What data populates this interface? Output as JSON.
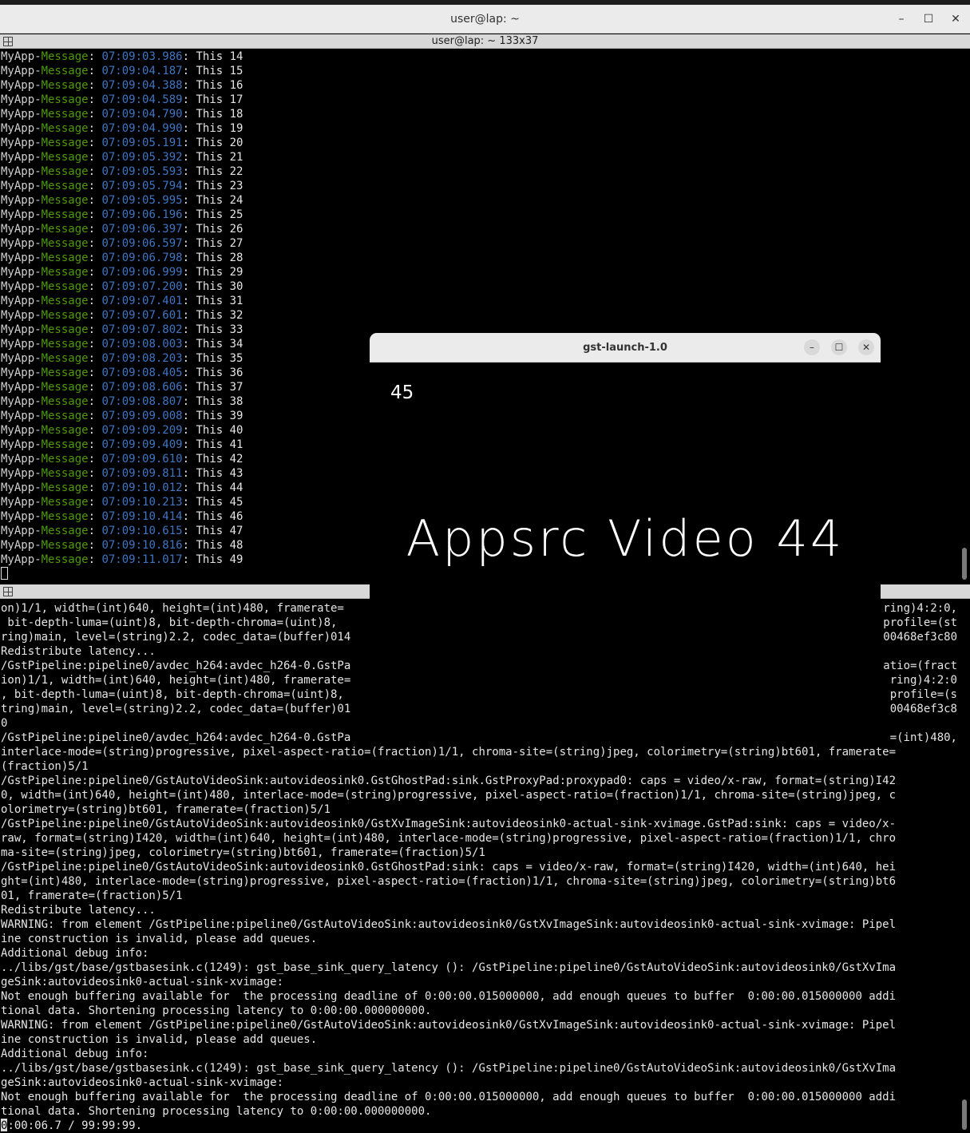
{
  "window": {
    "title": "user@lap: ~",
    "minimize": "–",
    "maximize": "☐",
    "close": "✕"
  },
  "top_pane": {
    "title": "user@lap: ~ 133x37",
    "lines": [
      {
        "app": "MyApp-",
        "level": "Message",
        "ts": "07:09:03.986",
        "text": ": This 14"
      },
      {
        "app": "MyApp-",
        "level": "Message",
        "ts": "07:09:04.187",
        "text": ": This 15"
      },
      {
        "app": "MyApp-",
        "level": "Message",
        "ts": "07:09:04.388",
        "text": ": This 16"
      },
      {
        "app": "MyApp-",
        "level": "Message",
        "ts": "07:09:04.589",
        "text": ": This 17"
      },
      {
        "app": "MyApp-",
        "level": "Message",
        "ts": "07:09:04.790",
        "text": ": This 18"
      },
      {
        "app": "MyApp-",
        "level": "Message",
        "ts": "07:09:04.990",
        "text": ": This 19"
      },
      {
        "app": "MyApp-",
        "level": "Message",
        "ts": "07:09:05.191",
        "text": ": This 20"
      },
      {
        "app": "MyApp-",
        "level": "Message",
        "ts": "07:09:05.392",
        "text": ": This 21"
      },
      {
        "app": "MyApp-",
        "level": "Message",
        "ts": "07:09:05.593",
        "text": ": This 22"
      },
      {
        "app": "MyApp-",
        "level": "Message",
        "ts": "07:09:05.794",
        "text": ": This 23"
      },
      {
        "app": "MyApp-",
        "level": "Message",
        "ts": "07:09:05.995",
        "text": ": This 24"
      },
      {
        "app": "MyApp-",
        "level": "Message",
        "ts": "07:09:06.196",
        "text": ": This 25"
      },
      {
        "app": "MyApp-",
        "level": "Message",
        "ts": "07:09:06.397",
        "text": ": This 26"
      },
      {
        "app": "MyApp-",
        "level": "Message",
        "ts": "07:09:06.597",
        "text": ": This 27"
      },
      {
        "app": "MyApp-",
        "level": "Message",
        "ts": "07:09:06.798",
        "text": ": This 28"
      },
      {
        "app": "MyApp-",
        "level": "Message",
        "ts": "07:09:06.999",
        "text": ": This 29"
      },
      {
        "app": "MyApp-",
        "level": "Message",
        "ts": "07:09:07.200",
        "text": ": This 30"
      },
      {
        "app": "MyApp-",
        "level": "Message",
        "ts": "07:09:07.401",
        "text": ": This 31"
      },
      {
        "app": "MyApp-",
        "level": "Message",
        "ts": "07:09:07.601",
        "text": ": This 32"
      },
      {
        "app": "MyApp-",
        "level": "Message",
        "ts": "07:09:07.802",
        "text": ": This 33"
      },
      {
        "app": "MyApp-",
        "level": "Message",
        "ts": "07:09:08.003",
        "text": ": This 34"
      },
      {
        "app": "MyApp-",
        "level": "Message",
        "ts": "07:09:08.203",
        "text": ": This 35"
      },
      {
        "app": "MyApp-",
        "level": "Message",
        "ts": "07:09:08.405",
        "text": ": This 36"
      },
      {
        "app": "MyApp-",
        "level": "Message",
        "ts": "07:09:08.606",
        "text": ": This 37"
      },
      {
        "app": "MyApp-",
        "level": "Message",
        "ts": "07:09:08.807",
        "text": ": This 38"
      },
      {
        "app": "MyApp-",
        "level": "Message",
        "ts": "07:09:09.008",
        "text": ": This 39"
      },
      {
        "app": "MyApp-",
        "level": "Message",
        "ts": "07:09:09.209",
        "text": ": This 40"
      },
      {
        "app": "MyApp-",
        "level": "Message",
        "ts": "07:09:09.409",
        "text": ": This 41"
      },
      {
        "app": "MyApp-",
        "level": "Message",
        "ts": "07:09:09.610",
        "text": ": This 42"
      },
      {
        "app": "MyApp-",
        "level": "Message",
        "ts": "07:09:09.811",
        "text": ": This 43"
      },
      {
        "app": "MyApp-",
        "level": "Message",
        "ts": "07:09:10.012",
        "text": ": This 44"
      },
      {
        "app": "MyApp-",
        "level": "Message",
        "ts": "07:09:10.213",
        "text": ": This 45"
      },
      {
        "app": "MyApp-",
        "level": "Message",
        "ts": "07:09:10.414",
        "text": ": This 46"
      },
      {
        "app": "MyApp-",
        "level": "Message",
        "ts": "07:09:10.615",
        "text": ": This 47"
      },
      {
        "app": "MyApp-",
        "level": "Message",
        "ts": "07:09:10.816",
        "text": ": This 48"
      },
      {
        "app": "MyApp-",
        "level": "Message",
        "ts": "07:09:11.017",
        "text": ": This 49"
      }
    ]
  },
  "bottom_pane": {
    "lines": [
      "on)1/1, width=(int)640, height=(int)480, framerate=",
      " bit-depth-luma=(uint)8, bit-depth-chroma=(uint)8, ",
      "ring)main, level=(string)2.2, codec_data=(buffer)014",
      "Redistribute latency...",
      "/GstPipeline:pipeline0/avdec_h264:avdec_h264-0.GstPa",
      "ion)1/1, width=(int)640, height=(int)480, framerate=",
      ", bit-depth-luma=(uint)8, bit-depth-chroma=(uint)8, ",
      "tring)main, level=(string)2.2, codec_data=(buffer)01",
      "0",
      "/GstPipeline:pipeline0/avdec_h264:avdec_h264-0.GstPa",
      "interlace-mode=(string)progressive, pixel-aspect-ratio=(fraction)1/1, chroma-site=(string)jpeg, colorimetry=(string)bt601, framerate=",
      "(fraction)5/1",
      "/GstPipeline:pipeline0/GstAutoVideoSink:autovideosink0.GstGhostPad:sink.GstProxyPad:proxypad0: caps = video/x-raw, format=(string)I42",
      "0, width=(int)640, height=(int)480, interlace-mode=(string)progressive, pixel-aspect-ratio=(fraction)1/1, chroma-site=(string)jpeg, c",
      "olorimetry=(string)bt601, framerate=(fraction)5/1",
      "/GstPipeline:pipeline0/GstAutoVideoSink:autovideosink0/GstXvImageSink:autovideosink0-actual-sink-xvimage.GstPad:sink: caps = video/x-",
      "raw, format=(string)I420, width=(int)640, height=(int)480, interlace-mode=(string)progressive, pixel-aspect-ratio=(fraction)1/1, chro",
      "ma-site=(string)jpeg, colorimetry=(string)bt601, framerate=(fraction)5/1",
      "/GstPipeline:pipeline0/GstAutoVideoSink:autovideosink0.GstGhostPad:sink: caps = video/x-raw, format=(string)I420, width=(int)640, hei",
      "ght=(int)480, interlace-mode=(string)progressive, pixel-aspect-ratio=(fraction)1/1, chroma-site=(string)jpeg, colorimetry=(string)bt6",
      "01, framerate=(fraction)5/1",
      "Redistribute latency...",
      "WARNING: from element /GstPipeline:pipeline0/GstAutoVideoSink:autovideosink0/GstXvImageSink:autovideosink0-actual-sink-xvimage: Pipel",
      "ine construction is invalid, please add queues.",
      "Additional debug info:",
      "../libs/gst/base/gstbasesink.c(1249): gst_base_sink_query_latency (): /GstPipeline:pipeline0/GstAutoVideoSink:autovideosink0/GstXvIma",
      "geSink:autovideosink0-actual-sink-xvimage:",
      "Not enough buffering available for  the processing deadline of 0:00:00.015000000, add enough queues to buffer  0:00:00.015000000 addi",
      "tional data. Shortening processing latency to 0:00:00.000000000.",
      "WARNING: from element /GstPipeline:pipeline0/GstAutoVideoSink:autovideosink0/GstXvImageSink:autovideosink0-actual-sink-xvimage: Pipel",
      "ine construction is invalid, please add queues.",
      "Additional debug info:",
      "../libs/gst/base/gstbasesink.c(1249): gst_base_sink_query_latency (): /GstPipeline:pipeline0/GstAutoVideoSink:autovideosink0/GstXvIma",
      "geSink:autovideosink0-actual-sink-xvimage:",
      "Not enough buffering available for  the processing deadline of 0:00:00.015000000, add enough queues to buffer  0:00:00.015000000 addi",
      "tional data. Shortening processing latency to 0:00:00.000000000."
    ],
    "right_fragments": [
      "ring)4:2:0,",
      "profile=(st",
      "00468ef3c80",
      "",
      "atio=(fract",
      "ring)4:2:0",
      "profile=(s",
      "00468ef3c8",
      "",
      "=(int)480,"
    ],
    "status_first": "0",
    "status_rest": ":00:06.7 / 99:99:99."
  },
  "gst_window": {
    "title": "gst-launch-1.0",
    "minimize": "–",
    "maximize": "☐",
    "close": "✕",
    "frame_number": "45",
    "video_text": "Appsrc Video 44"
  }
}
